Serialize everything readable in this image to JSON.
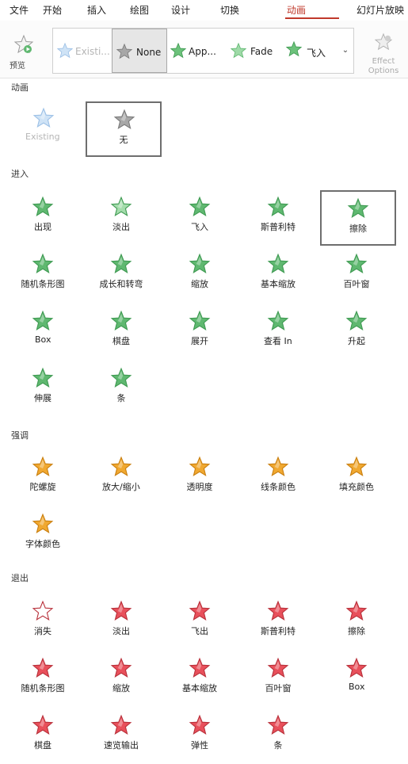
{
  "tabs": [
    "文件",
    "开始",
    "插入",
    "绘图",
    "设计",
    "切换",
    "动画",
    "幻灯片放映"
  ],
  "active_tab": "动画",
  "ribbon": {
    "preview_label": "预览",
    "gallery": [
      {
        "label": "Existi...",
        "icon": "existing-star",
        "state": "dim"
      },
      {
        "label": "None",
        "icon": "gray-star",
        "state": "selected"
      },
      {
        "label": "App...",
        "icon": "green-star-burst",
        "state": ""
      },
      {
        "label": "Fade",
        "icon": "green-star-fade",
        "state": ""
      },
      {
        "label": "飞入",
        "icon": "green-star-fly",
        "state": ""
      }
    ],
    "effect_label": "Effect Options"
  },
  "colors": {
    "accent": "#c0392b",
    "entrance": "#5fb870",
    "emphasis": "#f0a830",
    "exit": "#e8505b",
    "none": "#9a9a9a"
  },
  "sections": {
    "animation": {
      "title": "动画",
      "items": [
        {
          "label": "Existing",
          "state": "dim"
        },
        {
          "label": "无",
          "state": "selected"
        }
      ]
    },
    "entrance": {
      "title": "进入",
      "items": [
        {
          "label": "出现"
        },
        {
          "label": "淡出"
        },
        {
          "label": "飞入"
        },
        {
          "label": "斯普利特"
        },
        {
          "label": "擦除",
          "state": "selected"
        },
        {
          "label": "随机条形图"
        },
        {
          "label": "成长和转弯"
        },
        {
          "label": "缩放"
        },
        {
          "label": "基本缩放"
        },
        {
          "label": "百叶窗"
        },
        {
          "label": "Box"
        },
        {
          "label": "棋盘"
        },
        {
          "label": "展开"
        },
        {
          "label": "查看 In"
        },
        {
          "label": "升起"
        },
        {
          "label": "伸展"
        },
        {
          "label": "条"
        }
      ]
    },
    "emphasis": {
      "title": "强调",
      "items": [
        {
          "label": "陀螺旋"
        },
        {
          "label": "放大/缩小"
        },
        {
          "label": "透明度"
        },
        {
          "label": "线条颜色"
        },
        {
          "label": "填充颜色"
        },
        {
          "label": "字体颜色"
        }
      ]
    },
    "exit": {
      "title": "退出",
      "items": [
        {
          "label": "消失"
        },
        {
          "label": "淡出"
        },
        {
          "label": "飞出"
        },
        {
          "label": "斯普利特"
        },
        {
          "label": "擦除"
        },
        {
          "label": "随机条形图"
        },
        {
          "label": "缩放"
        },
        {
          "label": "基本缩放"
        },
        {
          "label": "百叶窗"
        },
        {
          "label": "Box"
        },
        {
          "label": "棋盘"
        },
        {
          "label": "速览输出"
        },
        {
          "label": "弹性"
        },
        {
          "label": "条"
        }
      ]
    }
  }
}
